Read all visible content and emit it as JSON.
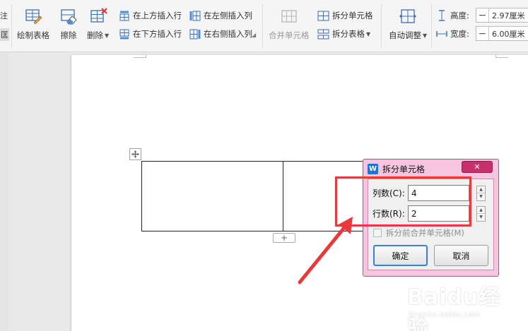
{
  "ribbon": {
    "left_edge": [
      "注",
      "匡"
    ],
    "draw_table": "绘制表格",
    "erase": "擦除",
    "delete": "删除",
    "insert_above": "在上方插入行",
    "insert_below": "在下方插入行",
    "insert_left": "在左侧插入列",
    "insert_right": "在右侧插入列",
    "merge_cells": "合并单元格",
    "split_cells": "拆分单元格",
    "split_table": "拆分表格",
    "auto_fit": "自动调整",
    "height_label": "高度:",
    "height_value": "2.97厘米",
    "width_label": "宽度:",
    "width_value": "6.00厘米",
    "minus": "−"
  },
  "table": {
    "columns": 2,
    "rows": 1,
    "add_row": "+",
    "move_handle_icon": "move-cross-icon"
  },
  "dialog": {
    "title": "拆分单元格",
    "logo": "W",
    "close": "✕",
    "columns_label": "列数(C):",
    "columns_value": "4",
    "rows_label": "行数(R):",
    "rows_value": "2",
    "merge_before_split": "拆分前合并单元格(M)",
    "merge_before_split_checked": false,
    "ok": "确定",
    "cancel": "取消"
  },
  "annotation": {
    "color": "#e83a3a"
  },
  "watermark": {
    "brand": "Baidu经验",
    "url": "jingyan.baidu.com"
  },
  "colors": {
    "dialog_frame": "#f6c6e0",
    "close_button": "#c9306b",
    "wps_blue": "#1e74d2"
  }
}
